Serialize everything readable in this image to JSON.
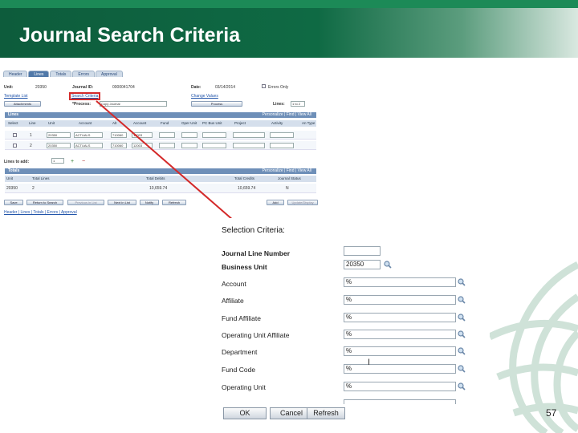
{
  "slide": {
    "title": "Journal Search Criteria",
    "page_number": "57"
  },
  "ps": {
    "tabs": [
      "Header",
      "Lines",
      "Totals",
      "Errors",
      "Approval"
    ],
    "header_fields": {
      "unit_label": "Unit:",
      "unit_value": "20350",
      "journal_id_label": "Journal ID:",
      "journal_id_value": "0000041704",
      "date_label": "Date:",
      "date_value": "03/14/2014",
      "errors_only": "Errors Only",
      "template_list": "Template List",
      "search_criteria": "Search Criteria",
      "change_values": "Change Values",
      "process_label": "*Process:",
      "process_value": "Copy Journal",
      "process_btn": "Process",
      "lines_label": "Lines:",
      "lines_value": "1 to 2",
      "attachments_btn": "Attachments"
    },
    "lines_bar": "Lines",
    "lines_bar_right": "Personalize | Find | View All",
    "grid_columns": [
      "Select",
      "Line",
      "Unit",
      "Account",
      "Alt",
      "Account",
      "Fund",
      "Oper Unit",
      "PC Bus Unit",
      "Project",
      "Activity",
      "An Type"
    ],
    "rows": [
      {
        "line": "1",
        "unit": "20350",
        "ledger": "ACTUALS",
        "account": "710060",
        "alt": "12003"
      },
      {
        "line": "2",
        "unit": "20350",
        "ledger": "ACTUALS",
        "account": "710060",
        "alt": "12003"
      }
    ],
    "lines_to_add_label": "Lines to add:",
    "lines_to_add_value": "1",
    "totals_bar": "Totals",
    "totals_bar_right": "Personalize | Find | View All",
    "totals_columns": [
      "Unit",
      "Total Lines",
      "Total Debits",
      "Total Credits",
      "Journal Status"
    ],
    "totals_row": {
      "unit": "20350",
      "lines": "2",
      "debits": "10,659.74",
      "credits": "10,659.74",
      "status": "N"
    },
    "bottom_buttons": [
      "Save",
      "Return to Search",
      "Previous in List",
      "Next in List",
      "Notify",
      "Refresh",
      "Add",
      "Update/Display"
    ],
    "bottom_links": "Header | Lines | Totals | Errors | Approval"
  },
  "criteria": {
    "title": "Selection Criteria:",
    "fields": [
      {
        "label": "Journal Line Number",
        "value": "",
        "bold": true
      },
      {
        "label": "Business Unit",
        "value": "20350",
        "bold": true
      },
      {
        "label": "Account",
        "value": "%",
        "bold": false
      },
      {
        "label": "Affiliate",
        "value": "%",
        "bold": false
      },
      {
        "label": "Fund Affiliate",
        "value": "%",
        "bold": false
      },
      {
        "label": "Operating Unit Affiliate",
        "value": "%",
        "bold": false
      },
      {
        "label": "Department",
        "value": "%",
        "bold": false
      },
      {
        "label": "Fund Code",
        "value": "%",
        "bold": false
      },
      {
        "label": "Operating Unit",
        "value": "%",
        "bold": false
      }
    ],
    "buttons": {
      "ok": "OK",
      "cancel": "Cancel",
      "refresh": "Refresh"
    }
  },
  "colors": {
    "header_green": "#0f6a44",
    "arrow_red": "#d42a2a",
    "ps_blue": "#6e8fb8"
  }
}
